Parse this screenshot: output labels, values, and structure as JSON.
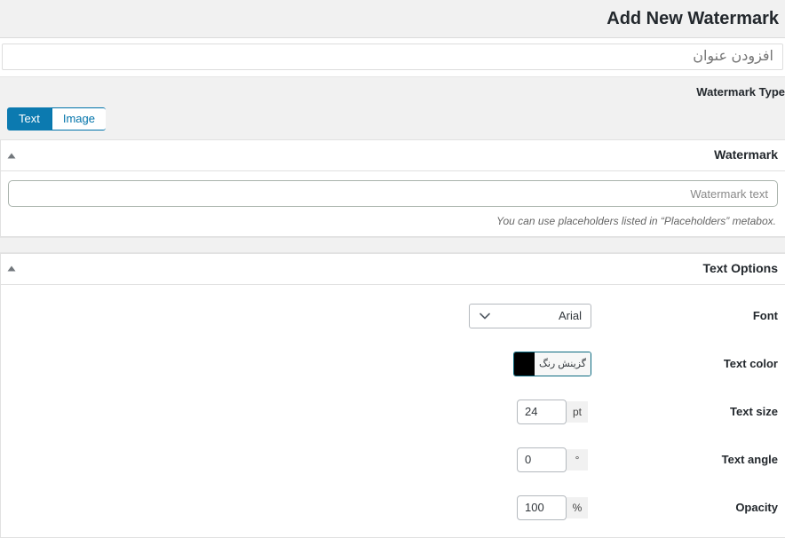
{
  "header": {
    "title": "Add New Watermark"
  },
  "title_field": {
    "value": "",
    "placeholder": "افزودن عنوان"
  },
  "watermark_type": {
    "label": "Watermark Type",
    "options": [
      {
        "label": "Image",
        "active": false
      },
      {
        "label": "Text",
        "active": true
      }
    ],
    "active_color": "#0c7ab0",
    "accent_color": "#0073aa"
  },
  "watermark_box": {
    "title": "Watermark",
    "toggle_icon": "triangle-up-icon",
    "text_input": {
      "value": "",
      "placeholder": "Watermark text"
    },
    "description": ".You can use placeholders listed in “Placeholders” metabox"
  },
  "text_options_box": {
    "title": "Text Options",
    "toggle_icon": "triangle-up-icon",
    "rows": [
      {
        "label": "Font",
        "type": "select",
        "value": "Arial",
        "icon": "chevron-down-icon"
      },
      {
        "label": "Text color",
        "type": "color",
        "button_label": "گزینش رنگ",
        "value": "#000000"
      },
      {
        "label": "Text size",
        "type": "number",
        "value": "24",
        "unit": "pt"
      },
      {
        "label": "Text angle",
        "type": "number",
        "value": "0",
        "unit": "°"
      },
      {
        "label": "Opacity",
        "type": "number",
        "value": "100",
        "unit": "%"
      }
    ]
  }
}
